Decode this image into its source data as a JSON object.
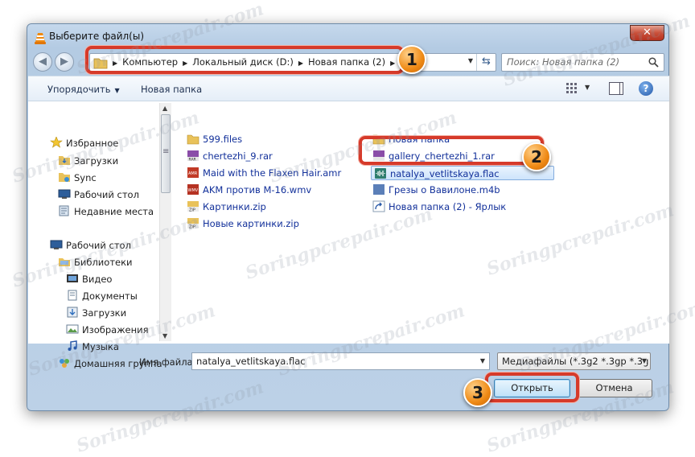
{
  "window": {
    "title": "Выберите файл(ы)",
    "close_label": "✕"
  },
  "nav": {
    "breadcrumbs": [
      "Компьютер",
      "Локальный диск (D:)",
      "Новая папка (2)"
    ],
    "search_placeholder": "Поиск: Новая папка (2)"
  },
  "toolbar": {
    "organize_label": "Упорядочить",
    "new_folder_label": "Новая папка"
  },
  "sidebar": {
    "favorites": [
      "Избранное",
      "Загрузки",
      "Sync",
      "Рабочий стол",
      "Недавние места"
    ],
    "desktop": [
      "Рабочий стол",
      "Библиотеки",
      "Видео",
      "Документы",
      "Загрузки",
      "Изображения",
      "Музыка",
      "Домашняя группа"
    ]
  },
  "files": {
    "col1": [
      "599.files",
      "chertezhi_9.rar",
      "Maid with the Flaxen Hair.amr",
      "AKM против M-16.wmv",
      "Картинки.zip",
      "Новые картинки.zip"
    ],
    "col2": [
      "Новая папка",
      "gallery_chertezhi_1.rar",
      "natalya_vetlitskaya.flac",
      "Грезы о Вавилоне.m4b",
      "Новая папка (2) - Ярлык"
    ]
  },
  "bottom": {
    "filename_label": "Имя файла:",
    "filename_value": "natalya_vetlitskaya.flac",
    "filter_value": "Медиафайлы (*.3g2 *.3gp *.3g",
    "open_label": "Открыть",
    "cancel_label": "Отмена"
  },
  "callouts": [
    "1",
    "2",
    "3"
  ],
  "watermark": "Soringpcrepair.com",
  "colors": {
    "callout_border": "#d63a2a",
    "callout_badge": "#ef8a15",
    "link_text": "#12309a"
  }
}
